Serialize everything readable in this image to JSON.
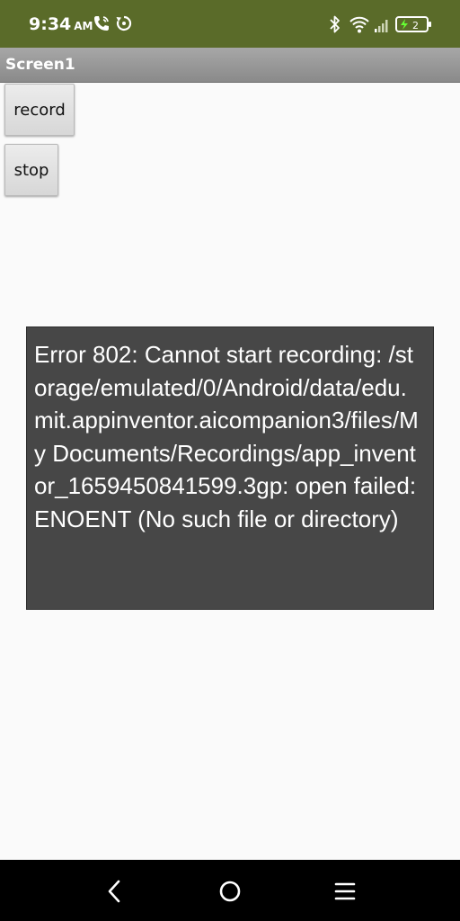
{
  "status_bar": {
    "time": "9:34",
    "ampm": "AM",
    "battery_level": "2",
    "icons": [
      "wifi-calling-icon",
      "sync-icon",
      "bluetooth-icon",
      "wifi-icon",
      "signal-icon",
      "battery-charging-icon"
    ]
  },
  "title_bar": {
    "title": "Screen1"
  },
  "buttons": {
    "record_label": "record",
    "stop_label": "stop"
  },
  "error": {
    "message": "Error 802: Cannot start recording: /storage/emulated/0/Android/data/edu.mit.appinventor.aicompanion3/files/My Documents/Recordings/app_inventor_1659450841599.3gp: open failed: ENOENT (No such file or directory)"
  },
  "nav_bar": {
    "icons": [
      "back-icon",
      "home-icon",
      "menu-icon"
    ]
  },
  "colors": {
    "status_bar": "#5a6b29",
    "title_bar": "#9a9a9a",
    "background": "#fafafa",
    "error_box": "#474747",
    "nav_bar": "#000000"
  }
}
